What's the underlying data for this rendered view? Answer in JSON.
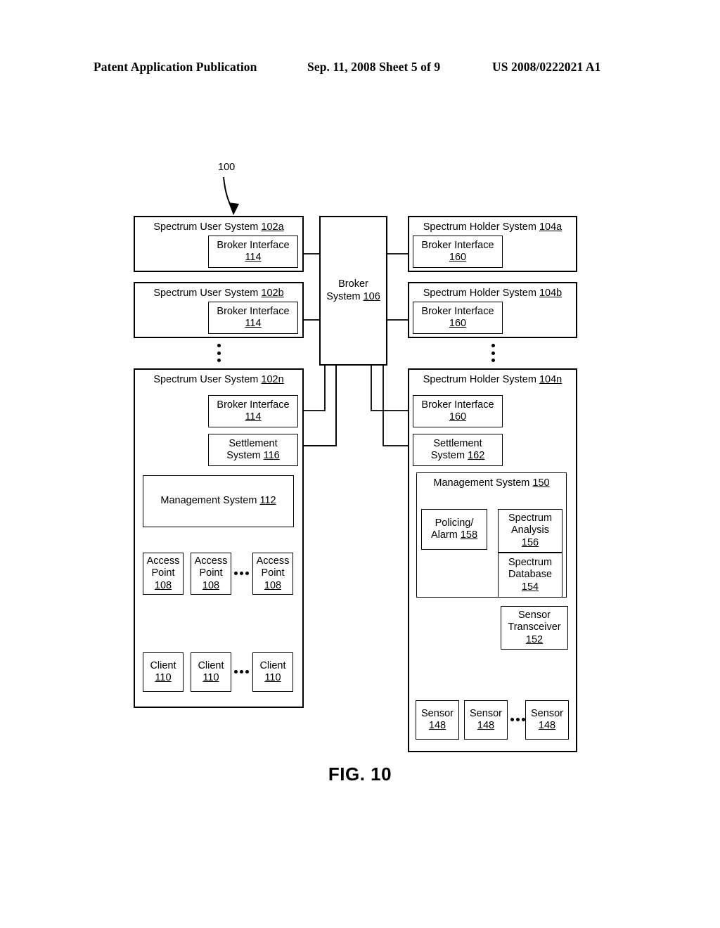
{
  "header": {
    "left": "Patent Application Publication",
    "middle": "Sep. 11, 2008  Sheet 5 of 9",
    "right": "US 2008/0222021 A1"
  },
  "figure": {
    "caption": "FIG. 10",
    "system_label": "100"
  },
  "diagram": {
    "user_systems": [
      {
        "title": "Spectrum User System",
        "ref": "102a"
      },
      {
        "title": "Spectrum User System",
        "ref": "102b"
      },
      {
        "title": "Spectrum User System",
        "ref": "102n"
      }
    ],
    "holder_systems": [
      {
        "title": "Spectrum Holder System",
        "ref": "104a"
      },
      {
        "title": "Spectrum Holder System",
        "ref": "104b"
      },
      {
        "title": "Spectrum Holder System",
        "ref": "104n"
      }
    ],
    "broker_system": {
      "line1": "Broker",
      "line2": "System",
      "ref": "106"
    },
    "user_broker_interface": {
      "title": "Broker Interface",
      "ref": "114"
    },
    "holder_broker_interface": {
      "title": "Broker Interface",
      "ref": "160"
    },
    "user_settlement_system": {
      "line1": "Settlement",
      "line2": "System",
      "ref": "116"
    },
    "holder_settlement_system": {
      "line1": "Settlement",
      "line2": "System",
      "ref": "162"
    },
    "user_management_system": {
      "title": "Management System",
      "ref": "112"
    },
    "holder_management_system": {
      "title": "Management System",
      "ref": "150"
    },
    "policing_alarm": {
      "line1": "Policing/",
      "line2": "Alarm",
      "ref": "158"
    },
    "spectrum_analysis": {
      "line1": "Spectrum",
      "line2": "Analysis",
      "ref": "156"
    },
    "spectrum_database": {
      "line1": "Spectrum",
      "line2": "Database",
      "ref": "154"
    },
    "sensor_transceiver": {
      "line1": "Sensor",
      "line2": "Transceiver",
      "ref": "152"
    },
    "access_points": [
      {
        "line1": "Access",
        "line2": "Point",
        "ref": "108"
      },
      {
        "line1": "Access",
        "line2": "Point",
        "ref": "108"
      },
      {
        "line1": "Access",
        "line2": "Point",
        "ref": "108"
      }
    ],
    "clients": [
      {
        "title": "Client",
        "ref": "110"
      },
      {
        "title": "Client",
        "ref": "110"
      },
      {
        "title": "Client",
        "ref": "110"
      }
    ],
    "sensors": [
      {
        "title": "Sensor",
        "ref": "148"
      },
      {
        "title": "Sensor",
        "ref": "148"
      },
      {
        "title": "Sensor",
        "ref": "148"
      }
    ]
  },
  "colors": {
    "ink": "#000000",
    "paper": "#ffffff"
  }
}
